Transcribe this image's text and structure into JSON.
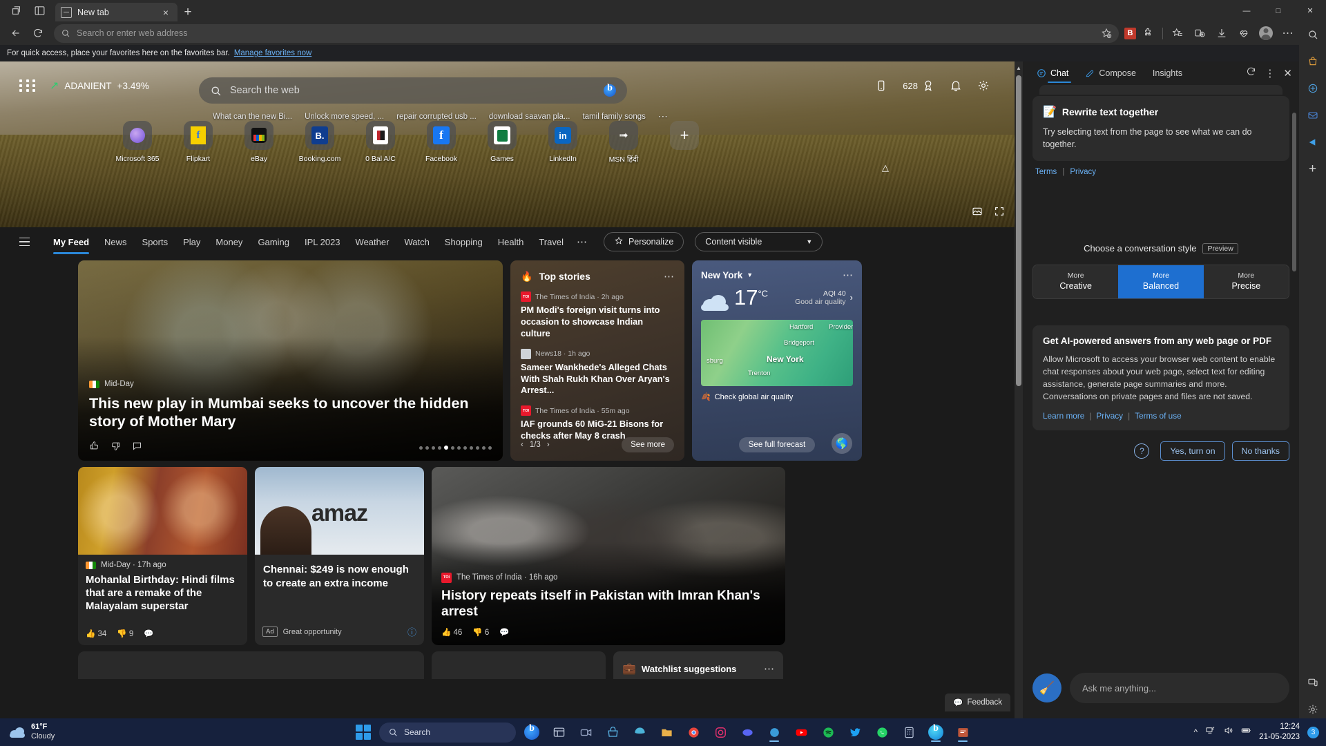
{
  "browser": {
    "tab": {
      "title": "New tab",
      "close_label": "×"
    },
    "new_tab_label": "+",
    "omnibox": {
      "placeholder": "Search or enter web address"
    },
    "favorites_bar": {
      "text": "For quick access, place your favorites here on the favorites bar.",
      "link": "Manage favorites now"
    },
    "window_controls": {
      "minimize": "—",
      "maximize": "□",
      "close": "✕"
    },
    "extension_badge": "B"
  },
  "hero": {
    "stock": {
      "symbol": "ADANIENT",
      "change": "+3.49%"
    },
    "search": {
      "placeholder": "Search the web"
    },
    "suggestions": [
      "What can the new Bi...",
      "Unlock more speed, ...",
      "repair corrupted usb ...",
      "download saavan pla...",
      "tamil family songs"
    ],
    "suggestions_more": "⋯",
    "rewards": "628",
    "quicklinks": [
      {
        "label": "Microsoft 365",
        "icon": "microsoft365-icon"
      },
      {
        "label": "Flipkart",
        "icon": "flipkart-icon"
      },
      {
        "label": "eBay",
        "icon": "ebay-icon"
      },
      {
        "label": "Booking.com",
        "icon": "booking-icon"
      },
      {
        "label": "0 Bal A/C",
        "icon": "bank-icon"
      },
      {
        "label": "Facebook",
        "icon": "facebook-icon"
      },
      {
        "label": "Games",
        "icon": "games-icon"
      },
      {
        "label": "LinkedIn",
        "icon": "linkedin-icon"
      },
      {
        "label": "MSN हिंदी",
        "icon": "msn-hindi-icon"
      }
    ],
    "add_shortcut": "+"
  },
  "feednav": {
    "items": [
      "My Feed",
      "News",
      "Sports",
      "Play",
      "Money",
      "Gaming",
      "IPL 2023",
      "Weather",
      "Watch",
      "Shopping",
      "Health",
      "Travel"
    ],
    "active": "My Feed",
    "more": "⋯",
    "personalize": "Personalize",
    "content_visibility": "Content visible"
  },
  "feed": {
    "lead": {
      "source": "Mid-Day",
      "title": "This new play in Mumbai seeks to uncover the hidden story of Mother Mary"
    },
    "top_stories": {
      "heading": "Top stories",
      "items": [
        {
          "source": "The Times of India · 2h ago",
          "title": "PM Modi's foreign visit turns into occasion to showcase Indian culture"
        },
        {
          "source": "News18 · 1h ago",
          "title": "Sameer Wankhede's Alleged Chats With Shah Rukh Khan Over Aryan's Arrest..."
        },
        {
          "source": "The Times of India · 55m ago",
          "title": "IAF grounds 60 MiG-21 Bisons for checks after May 8 crash"
        }
      ],
      "pager": "1/3",
      "see_more": "See more"
    },
    "weather": {
      "city": "New York",
      "temp": "17",
      "unit": "°C",
      "aqi": "AQI 40",
      "aqi_desc": "Good air quality",
      "map_labels": [
        "Hartford",
        "Providence",
        "Bridgeport",
        "New York",
        "Trenton",
        "sburg"
      ],
      "check_air": "Check global air quality",
      "see_forecast": "See full forecast"
    },
    "card_mohanlal": {
      "source": "Mid-Day · 17h ago",
      "title": "Mohanlal Birthday: Hindi films that are a remake of the Malayalam superstar",
      "likes": "34",
      "dislikes": "9"
    },
    "card_ad": {
      "title": "Chennai: $249 is now enough to create an extra income",
      "ad_tag": "Ad",
      "ad_text": "Great opportunity"
    },
    "card_imran": {
      "source": "The Times of India · 16h ago",
      "title": "History repeats itself in Pakistan with Imran Khan's arrest",
      "likes": "46",
      "dislikes": "6"
    },
    "watchlist_heading": "Watchlist suggestions",
    "feedback": "Feedback"
  },
  "sidebar": {
    "tabs": [
      {
        "label": "Chat",
        "icon": "chat-icon",
        "active": true
      },
      {
        "label": "Compose",
        "icon": "compose-icon",
        "active": false
      },
      {
        "label": "Insights",
        "icon": "insights-icon",
        "active": false
      }
    ],
    "rewrite": {
      "title": "Rewrite text together",
      "body": "Try selecting text from the page to see what we can do together."
    },
    "legal": {
      "terms": "Terms",
      "sep": "|",
      "privacy": "Privacy"
    },
    "style": {
      "label": "Choose a conversation style",
      "preview_tag": "Preview",
      "options": [
        {
          "top": "More",
          "bottom": "Creative",
          "selected": false
        },
        {
          "top": "More",
          "bottom": "Balanced",
          "selected": true
        },
        {
          "top": "More",
          "bottom": "Precise",
          "selected": false
        }
      ]
    },
    "consent": {
      "title": "Get AI-powered answers from any web page or PDF",
      "body": "Allow Microsoft to access your browser web content to enable chat responses about your web page, select text for editing assistance, generate page summaries and more. Conversations on private pages and files are not saved.",
      "links": [
        "Learn more",
        "Privacy",
        "Terms of use"
      ],
      "help_icon": "?",
      "accept": "Yes, turn on",
      "decline": "No thanks"
    },
    "composer": {
      "placeholder": "Ask me anything...",
      "broom_icon": "broom-icon"
    }
  },
  "taskbar": {
    "weather": {
      "temp": "61°F",
      "condition": "Cloudy"
    },
    "search_placeholder": "Search",
    "clock": {
      "time": "12:24",
      "date": "21-05-2023"
    },
    "badge": "3"
  }
}
